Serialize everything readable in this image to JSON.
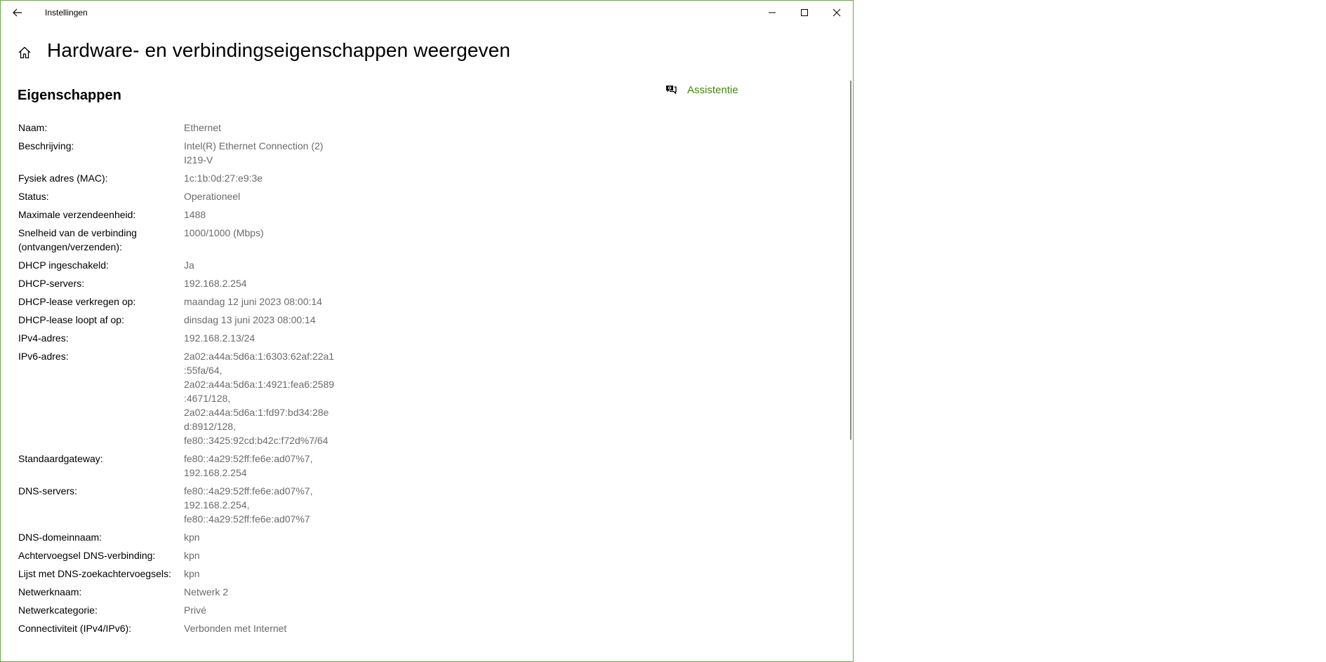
{
  "window": {
    "title": "Instellingen"
  },
  "page": {
    "title": "Hardware- en verbindingseigenschappen weergeven"
  },
  "section": {
    "title": "Eigenschappen"
  },
  "assist": {
    "label": "Assistentie"
  },
  "colors": {
    "accent": "#3f8a0c",
    "window_border": "#6aa84f",
    "value_text": "#6b6b6b"
  },
  "properties": [
    {
      "label": "Naam:",
      "values": [
        "Ethernet"
      ]
    },
    {
      "label": "Beschrijving:",
      "values": [
        "Intel(R) Ethernet Connection (2)",
        "I219-V"
      ]
    },
    {
      "label": "Fysiek adres (MAC):",
      "values": [
        "1c:1b:0d:27:e9:3e"
      ]
    },
    {
      "label": "Status:",
      "values": [
        "Operationeel"
      ]
    },
    {
      "label": "Maximale verzendeenheid:",
      "values": [
        "1488"
      ]
    },
    {
      "label": "Snelheid van de verbinding (ontvangen/verzenden):",
      "values": [
        "1000/1000 (Mbps)"
      ]
    },
    {
      "label": "DHCP ingeschakeld:",
      "values": [
        "Ja"
      ]
    },
    {
      "label": "DHCP-servers:",
      "values": [
        "192.168.2.254"
      ]
    },
    {
      "label": "DHCP-lease verkregen op:",
      "values": [
        "maandag 12 juni 2023 08:00:14"
      ]
    },
    {
      "label": "DHCP-lease loopt af op:",
      "values": [
        "dinsdag 13 juni 2023 08:00:14"
      ]
    },
    {
      "label": "IPv4-adres:",
      "values": [
        "192.168.2.13/24"
      ]
    },
    {
      "label": "IPv6-adres:",
      "values": [
        "2a02:a44a:5d6a:1:6303:62af:22a1",
        ":55fa/64,",
        "2a02:a44a:5d6a:1:4921:fea6:2589",
        ":4671/128,",
        "2a02:a44a:5d6a:1:fd97:bd34:28e",
        "d:8912/128,",
        "fe80::3425:92cd:b42c:f72d%7/64"
      ]
    },
    {
      "label": "Standaardgateway:",
      "values": [
        "fe80::4a29:52ff:fe6e:ad07%7,",
        "192.168.2.254"
      ]
    },
    {
      "label": "DNS-servers:",
      "values": [
        "fe80::4a29:52ff:fe6e:ad07%7,",
        "192.168.2.254,",
        "fe80::4a29:52ff:fe6e:ad07%7"
      ]
    },
    {
      "label": "DNS-domeinnaam:",
      "values": [
        "kpn"
      ]
    },
    {
      "label": "Achtervoegsel DNS-verbinding:",
      "values": [
        "kpn"
      ]
    },
    {
      "label": "Lijst met DNS-zoekachtervoegsels:",
      "values": [
        "kpn"
      ]
    },
    {
      "label": "Netwerknaam:",
      "values": [
        "Netwerk 2"
      ]
    },
    {
      "label": "Netwerkcategorie:",
      "values": [
        "Privé"
      ]
    },
    {
      "label": "Connectiviteit (IPv4/IPv6):",
      "values": [
        "Verbonden met Internet"
      ]
    }
  ]
}
